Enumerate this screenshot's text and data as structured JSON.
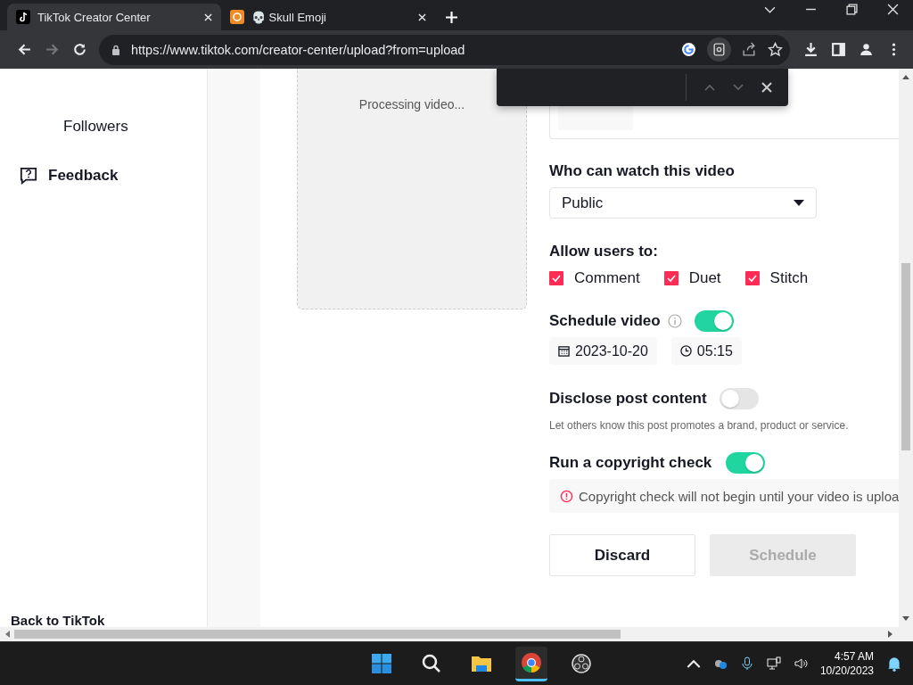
{
  "browser": {
    "tabs": [
      {
        "title": "TikTok Creator Center",
        "selected": true,
        "kind": "tiktok"
      },
      {
        "title": "💀 Skull Emoji",
        "selected": false,
        "kind": "emoji"
      }
    ],
    "url": "https://www.tiktok.com/creator-center/upload?from=upload"
  },
  "sidebar": {
    "items": [
      {
        "label": "Followers",
        "kind": "plain"
      },
      {
        "label": "Feedback",
        "kind": "feedback"
      }
    ],
    "back_link": "Back to TikTok"
  },
  "video": {
    "status": "Processing video..."
  },
  "form": {
    "visibility": {
      "label": "Who can watch this video",
      "value": "Public"
    },
    "allow": {
      "label": "Allow users to:",
      "options": [
        {
          "label": "Comment",
          "checked": true
        },
        {
          "label": "Duet",
          "checked": true
        },
        {
          "label": "Stitch",
          "checked": true
        }
      ]
    },
    "schedule": {
      "label": "Schedule video",
      "on": true,
      "date": "2023-10-20",
      "time": "05:15"
    },
    "disclose": {
      "label": "Disclose post content",
      "on": false,
      "hint": "Let others know this post promotes a brand, product or service."
    },
    "copyright": {
      "label": "Run a copyright check",
      "on": true,
      "notice": "Copyright check will not begin until your video is uploa"
    },
    "buttons": [
      {
        "label": "Discard",
        "disabled": false
      },
      {
        "label": "Schedule",
        "disabled": true
      }
    ]
  },
  "taskbar": {
    "time": "4:57 AM",
    "date": "10/20/2023"
  }
}
